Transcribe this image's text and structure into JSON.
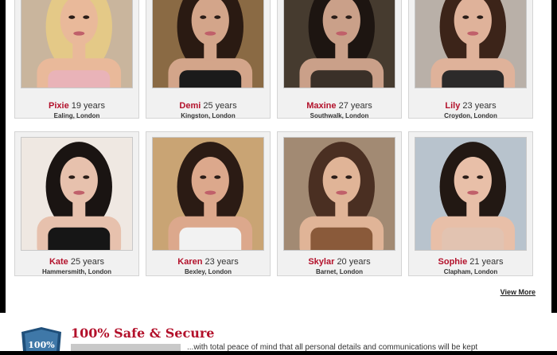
{
  "profiles": [
    {
      "name": "Pixie",
      "age": "19 years",
      "location": "Ealing, London",
      "bg": "#c9b59d",
      "hair": "#e4c987",
      "skin": "#e9b99a",
      "top": "#e9b3b8"
    },
    {
      "name": "Demi",
      "age": "25 years",
      "location": "Kingston, London",
      "bg": "#8a6a44",
      "hair": "#2a1a12",
      "skin": "#d3a58a",
      "top": "#1b1b1b"
    },
    {
      "name": "Maxine",
      "age": "27 years",
      "location": "Southwalk, London",
      "bg": "#463b2f",
      "hair": "#1d1511",
      "skin": "#caa089",
      "top": "#3a3028"
    },
    {
      "name": "Lily",
      "age": "23 years",
      "location": "Croydon, London",
      "bg": "#b9b0a8",
      "hair": "#3c2419",
      "skin": "#dfb29a",
      "top": "#2c2a2a"
    },
    {
      "name": "Kate",
      "age": "25 years",
      "location": "Hammersmith, London",
      "bg": "#efe8e2",
      "hair": "#1a1412",
      "skin": "#e7c1ad",
      "top": "#161616"
    },
    {
      "name": "Karen",
      "age": "23 years",
      "location": "Bexley, London",
      "bg": "#c9a474",
      "hair": "#2b1b14",
      "skin": "#dca88c",
      "top": "#f2f2f2"
    },
    {
      "name": "Skylar",
      "age": "20 years",
      "location": "Barnet, London",
      "bg": "#a28a73",
      "hair": "#4a2f22",
      "skin": "#e0b497",
      "top": "#8a5a3a"
    },
    {
      "name": "Sophie",
      "age": "21 years",
      "location": "Clapham, London",
      "bg": "#b8c3cd",
      "hair": "#221813",
      "skin": "#e8bfa8",
      "top": "#e2c3b1"
    }
  ],
  "view_more": "View More",
  "secure": {
    "badge_text": "100%",
    "title": "100% Safe & Secure",
    "text": "...with total peace of mind that all personal details and communications will be kept"
  }
}
